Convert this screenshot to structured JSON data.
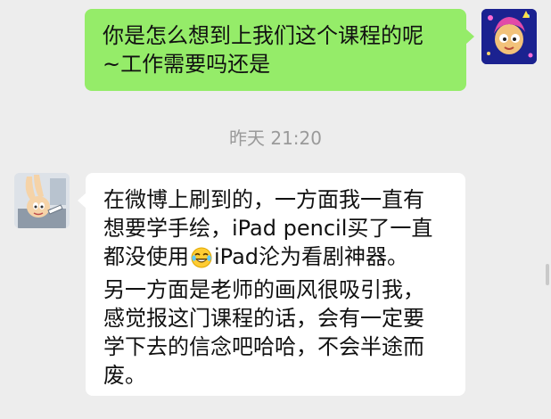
{
  "messages": {
    "outgoing": {
      "avatar_icon": "cartoon-avatar-icon",
      "lines": [
        "你是怎么想到上我们这个课程的呢",
        "~工作需要吗还是"
      ]
    },
    "timestamp": "昨天 21:20",
    "incoming": {
      "avatar_icon": "rabbit-avatar-icon",
      "lines": [
        "在微博上刷到的，一方面我一直有",
        "想要学手绘，iPad pencil买了一直",
        "都没使用",
        "iPad沦为看剧神器。",
        "另一方面是老师的画风很吸引我，",
        "感觉报这门课程的话，会有一定要",
        "学下去的信念吧哈哈，不会半途而",
        "废。"
      ],
      "emoji": "laughing-tears-icon"
    }
  },
  "colors": {
    "background": "#ededed",
    "outgoing_bubble": "#95ec69",
    "incoming_bubble": "#ffffff",
    "timestamp_text": "#9a9a9a"
  }
}
